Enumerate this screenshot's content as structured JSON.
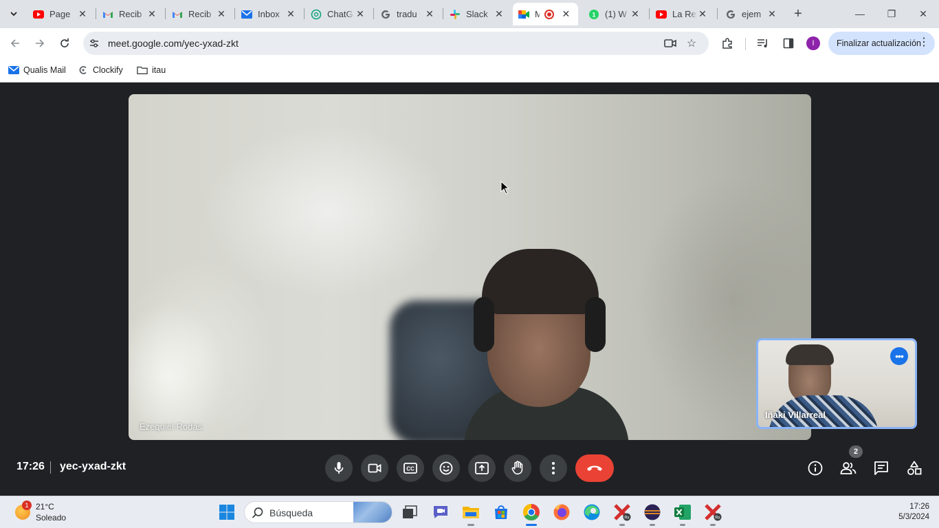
{
  "browser": {
    "tabs": [
      {
        "title": "Page",
        "icon": "youtube-icon"
      },
      {
        "title": "Recib",
        "icon": "gmail-icon"
      },
      {
        "title": "Recib",
        "icon": "gmail-icon"
      },
      {
        "title": "Inbox",
        "icon": "mail-icon"
      },
      {
        "title": "ChatG",
        "icon": "chatgpt-icon"
      },
      {
        "title": "tradu",
        "icon": "google-icon"
      },
      {
        "title": "Slack",
        "icon": "slack-icon"
      },
      {
        "title": "M",
        "icon": "meet-icon",
        "active": true,
        "recording": true
      },
      {
        "title": "(1) W",
        "icon": "whatsapp-icon"
      },
      {
        "title": "La Re",
        "icon": "youtube-icon"
      },
      {
        "title": "ejem",
        "icon": "google-icon"
      }
    ],
    "url": "meet.google.com/yec-yxad-zkt",
    "update_button": "Finalizar actualización",
    "profile_initial": "I",
    "bookmarks": [
      "Qualis Mail",
      "Clockify",
      "itau"
    ]
  },
  "meet": {
    "main_participant": "Ezequiel Rodas",
    "self_participant": "Iñaki Villarreal",
    "time": "17:26",
    "meeting_code": "yec-yxad-zkt",
    "participant_count": "2",
    "controls": [
      "microphone",
      "camera",
      "captions",
      "reactions",
      "present",
      "raise-hand",
      "more-options",
      "leave-call"
    ],
    "accent": "#8ab4f8",
    "end_call_color": "#ea4335"
  },
  "taskbar": {
    "weather_temp": "21°C",
    "weather_condition": "Soleado",
    "weather_badge": "1",
    "search_placeholder": "Búsqueda",
    "time": "17:26",
    "date": "5/3/2024"
  }
}
